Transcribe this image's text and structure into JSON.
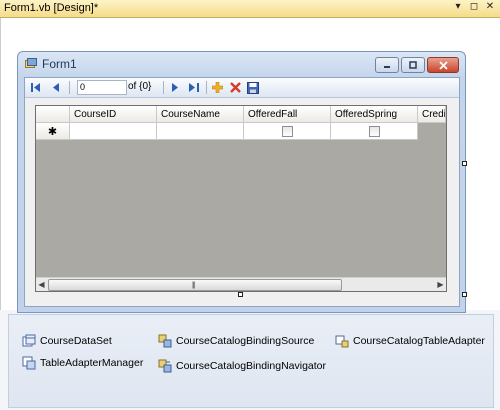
{
  "document_tab": {
    "title": "Form1.vb [Design]*",
    "buttons": [
      "window-position-icon",
      "pin-icon",
      "close-icon"
    ]
  },
  "form": {
    "title": "Form1",
    "controls": [
      "minimize-icon",
      "maximize-icon",
      "close-icon"
    ]
  },
  "navigator": {
    "position_value": "0",
    "count_label": "of {0}",
    "buttons": [
      "move-first",
      "move-previous",
      "move-next",
      "move-last",
      "add-new",
      "delete",
      "save"
    ]
  },
  "grid": {
    "columns": [
      "CourseID",
      "CourseName",
      "OfferedFall",
      "OfferedSpring",
      "Credi"
    ],
    "new_row_marker": "✱",
    "scroll_grip": "|||",
    "scroll_left": "◀",
    "scroll_right": "▶"
  },
  "component_tray": {
    "items": [
      "CourseDataSet",
      "CourseCatalogBindingSource",
      "CourseCatalogTableAdapter",
      "TableAdapterManager",
      "CourseCatalogBindingNavigator"
    ]
  },
  "colors": {
    "tab_header": "#f5dc8a",
    "form_chrome": "#c4d5eb",
    "grid_background": "#aba9a4",
    "tray_background": "#e3e9f3"
  }
}
